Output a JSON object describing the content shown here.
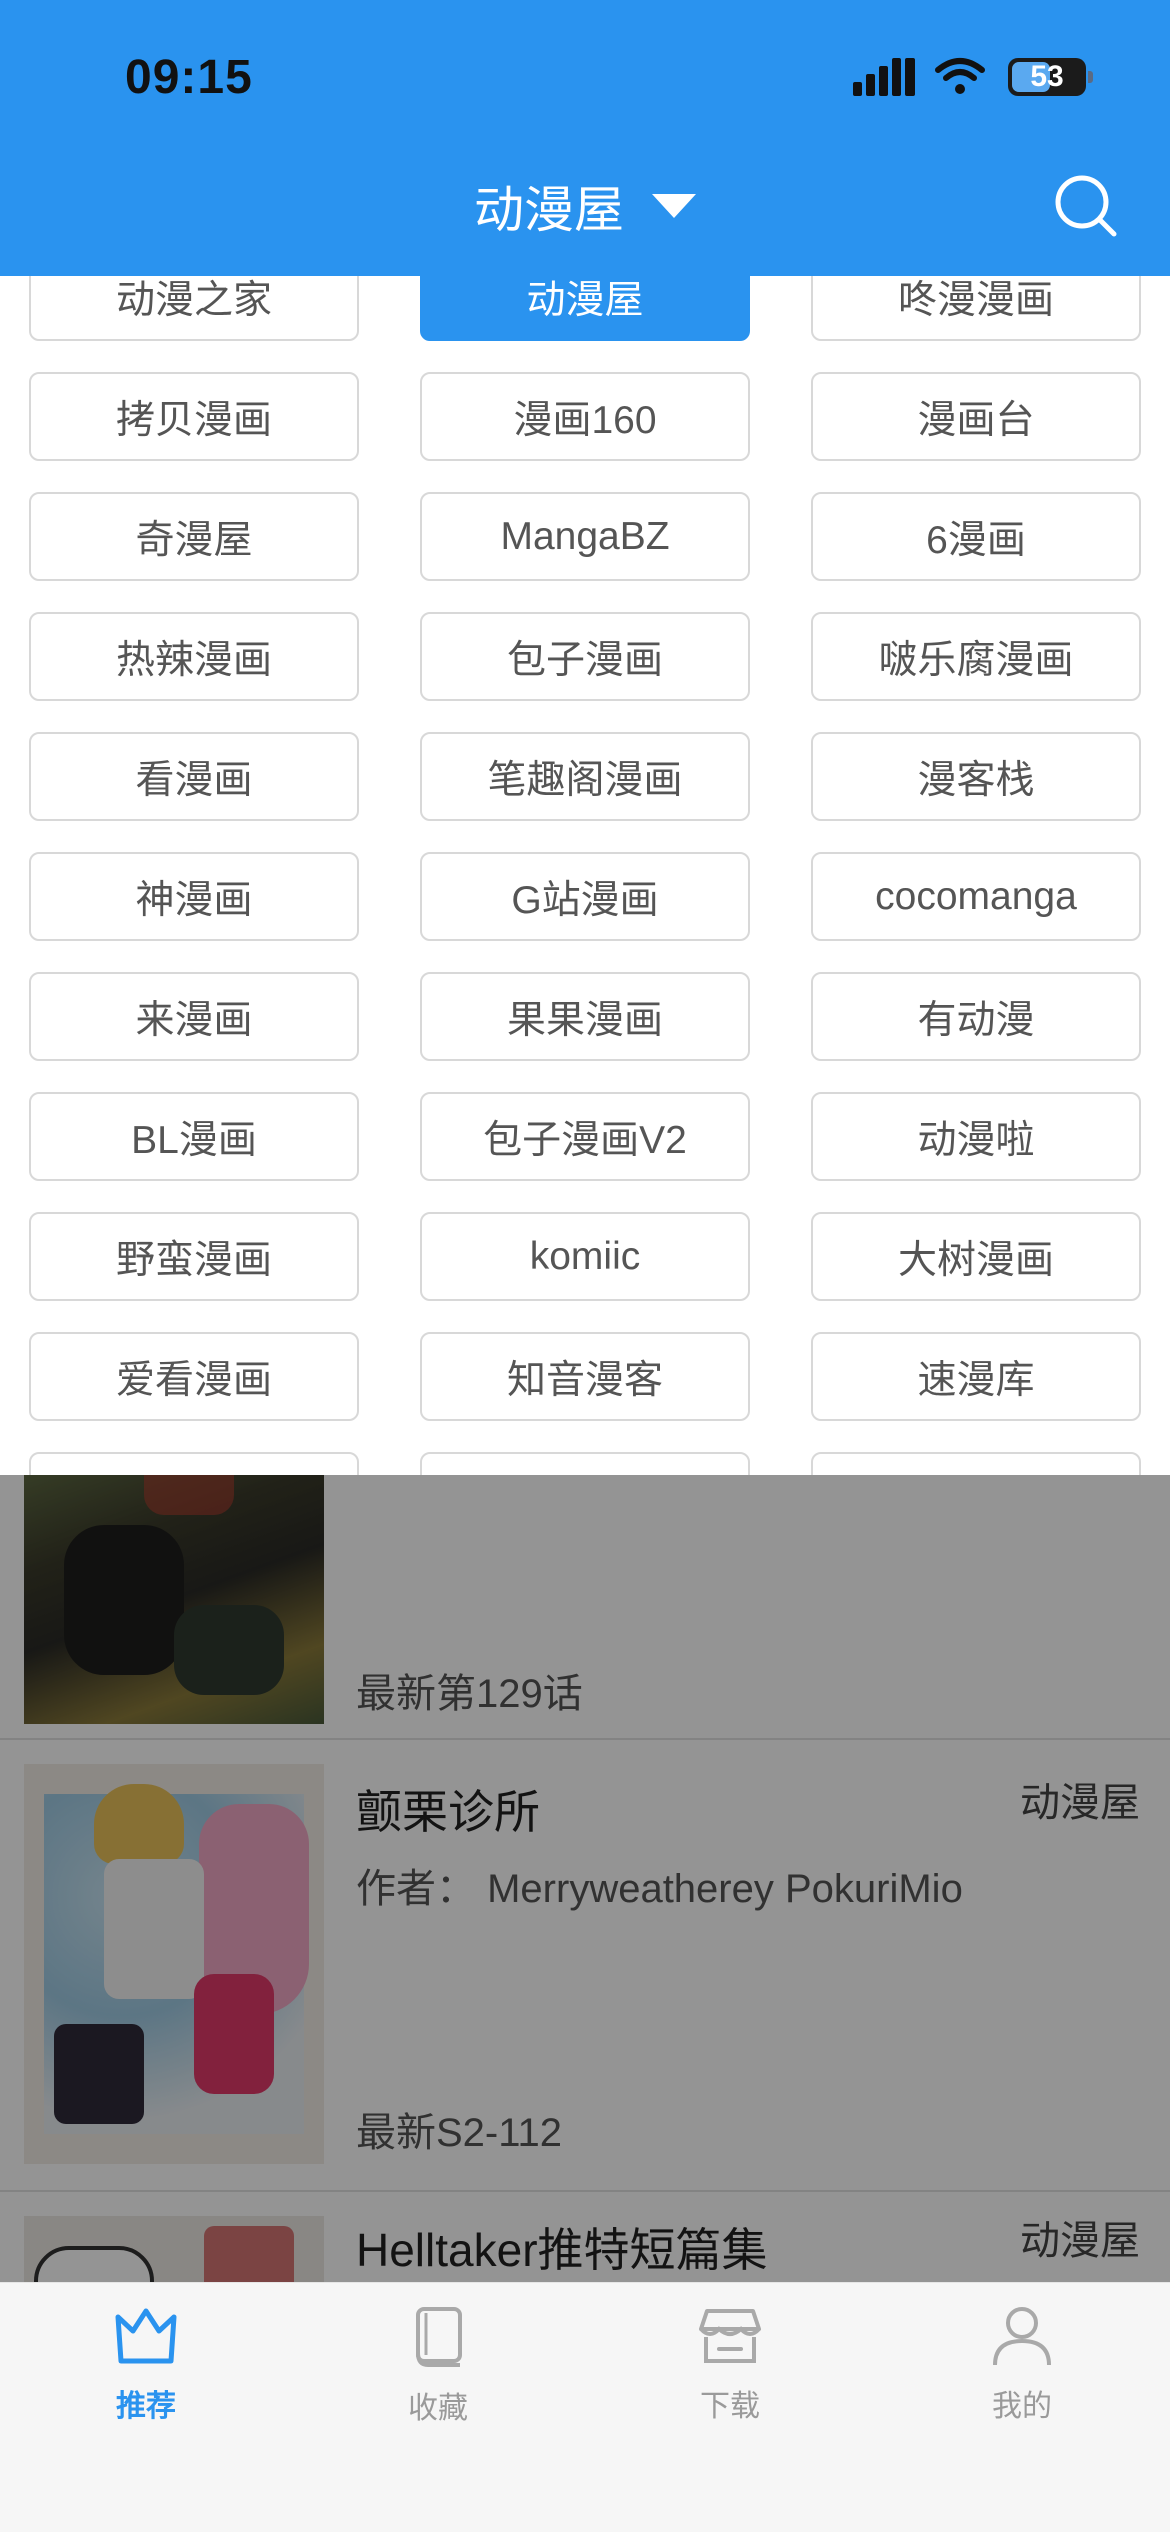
{
  "status": {
    "time": "09:15",
    "battery": "53"
  },
  "header": {
    "title": "动漫屋"
  },
  "sources": [
    {
      "label": "动漫之家",
      "active": false
    },
    {
      "label": "动漫屋",
      "active": true
    },
    {
      "label": "咚漫漫画",
      "active": false
    },
    {
      "label": "拷贝漫画",
      "active": false
    },
    {
      "label": "漫画160",
      "active": false
    },
    {
      "label": "漫画台",
      "active": false
    },
    {
      "label": "奇漫屋",
      "active": false
    },
    {
      "label": "MangaBZ",
      "active": false
    },
    {
      "label": "6漫画",
      "active": false
    },
    {
      "label": "热辣漫画",
      "active": false
    },
    {
      "label": "包子漫画",
      "active": false
    },
    {
      "label": "啵乐腐漫画",
      "active": false
    },
    {
      "label": "看漫画",
      "active": false
    },
    {
      "label": "笔趣阁漫画",
      "active": false
    },
    {
      "label": "漫客栈",
      "active": false
    },
    {
      "label": "神漫画",
      "active": false
    },
    {
      "label": "G站漫画",
      "active": false
    },
    {
      "label": "cocomanga",
      "active": false
    },
    {
      "label": "来漫画",
      "active": false
    },
    {
      "label": "果果漫画",
      "active": false
    },
    {
      "label": "有动漫",
      "active": false
    },
    {
      "label": "BL漫画",
      "active": false
    },
    {
      "label": "包子漫画V2",
      "active": false
    },
    {
      "label": "动漫啦",
      "active": false
    },
    {
      "label": "野蛮漫画",
      "active": false
    },
    {
      "label": "komiic",
      "active": false
    },
    {
      "label": "大树漫画",
      "active": false
    },
    {
      "label": "爱看漫画",
      "active": false
    },
    {
      "label": "知音漫客",
      "active": false
    },
    {
      "label": "速漫库",
      "active": false
    },
    {
      "label": "",
      "active": false
    },
    {
      "label": "",
      "active": false
    },
    {
      "label": "",
      "active": false
    }
  ],
  "list": [
    {
      "title": "",
      "source": "",
      "author": "",
      "latest": "最新第129话"
    },
    {
      "title": "颤栗诊所",
      "source": "动漫屋",
      "author": "作者：  Merryweatherey PokuriMio",
      "latest": "最新S2-112"
    },
    {
      "title": "Helltaker推特短篇集",
      "source": "动漫屋",
      "author": "",
      "latest": ""
    }
  ],
  "tabs": [
    {
      "label": "推荐",
      "icon": "crown-icon",
      "active": true
    },
    {
      "label": "收藏",
      "icon": "book-icon",
      "active": false
    },
    {
      "label": "下载",
      "icon": "store-icon",
      "active": false
    },
    {
      "label": "我的",
      "icon": "person-icon",
      "active": false
    }
  ],
  "colors": {
    "accent": "#2a93ef",
    "tab_inactive": "#9a9a9a",
    "overlay": "rgba(0,0,0,0.42)"
  }
}
